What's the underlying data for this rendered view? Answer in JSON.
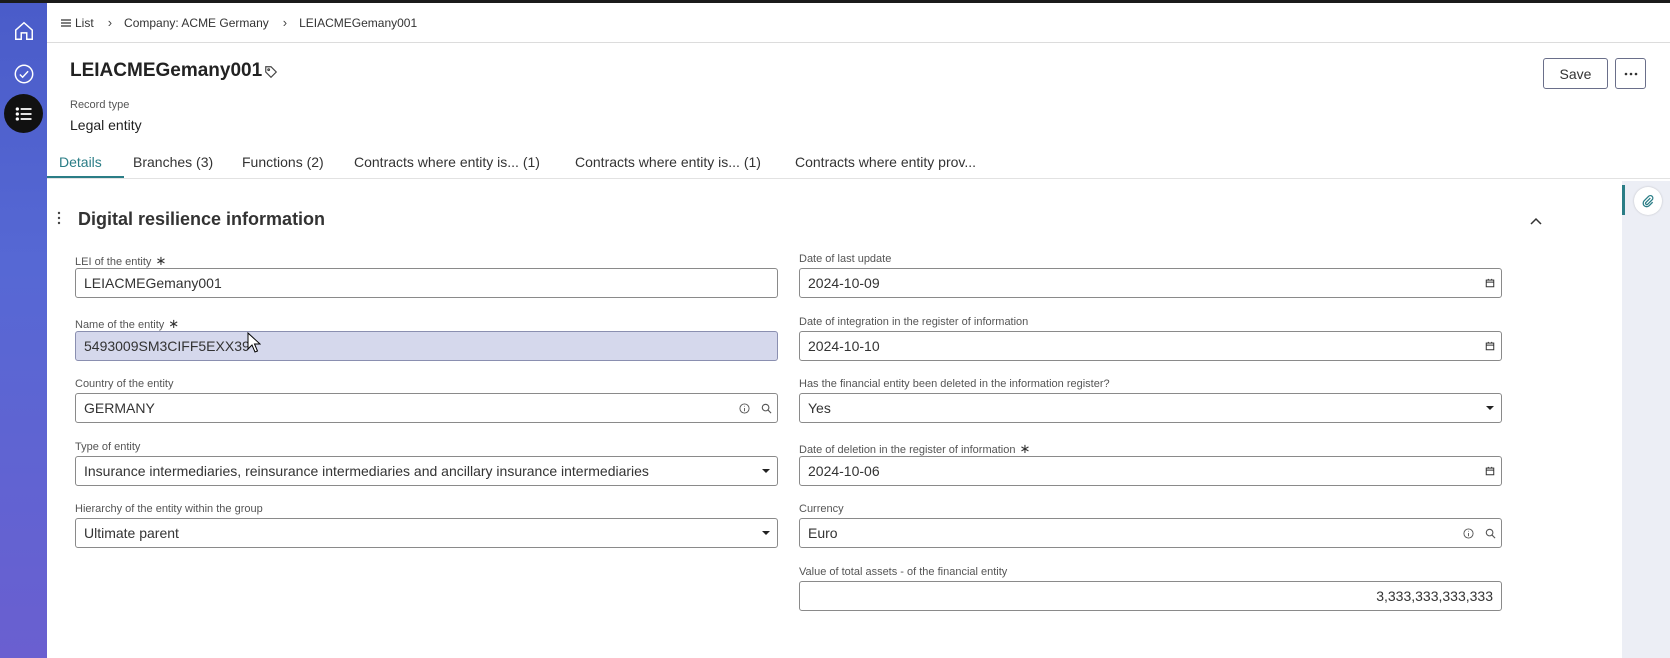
{
  "breadcrumb": {
    "items": [
      {
        "label": "List"
      },
      {
        "label": "Company: ACME Germany"
      },
      {
        "label": "LEIACMEGemany001"
      }
    ]
  },
  "record": {
    "title": "LEIACMEGemany001",
    "type_label": "Record type",
    "type_value": "Legal entity"
  },
  "toolbar": {
    "save_label": "Save"
  },
  "tabs": [
    {
      "label": "Details",
      "active": true
    },
    {
      "label": "Branches (3)"
    },
    {
      "label": "Functions (2)"
    },
    {
      "label": "Contracts where entity is... (1)"
    },
    {
      "label": "Contracts where entity is... (1)"
    },
    {
      "label": "Contracts where entity prov..."
    }
  ],
  "section": {
    "title": "Digital resilience information"
  },
  "fields": {
    "lei": {
      "label": "LEI of the entity",
      "required": "∗",
      "value": "LEIACMEGemany001"
    },
    "name": {
      "label": "Name of the entity",
      "required": "∗",
      "value": "5493009SM3CIFF5EXX39"
    },
    "country": {
      "label": "Country of the entity",
      "value": "GERMANY"
    },
    "type": {
      "label": "Type of entity",
      "value": "Insurance intermediaries, reinsurance intermediaries and ancillary insurance intermediaries"
    },
    "hierarchy": {
      "label": "Hierarchy of the entity within the group",
      "value": "Ultimate parent"
    },
    "last_update": {
      "label": "Date of last update",
      "value": "2024-10-09"
    },
    "integration": {
      "label": "Date of integration in the register of information",
      "value": "2024-10-10"
    },
    "deleted": {
      "label": "Has the financial entity been deleted in the information register?",
      "value": "Yes"
    },
    "deletion_date": {
      "label": "Date of deletion in the register of information",
      "required": "∗",
      "value": "2024-10-06"
    },
    "currency": {
      "label": "Currency",
      "value": "Euro"
    },
    "total_assets": {
      "label": "Value of total assets - of the financial entity",
      "value": "3,333,333,333,333"
    }
  },
  "colors": {
    "accent": "#2a7d86",
    "nav_gradient_top": "#4a5cc9",
    "nav_gradient_bottom": "#6a5fd0",
    "highlight_field": "#d5d8ec"
  }
}
